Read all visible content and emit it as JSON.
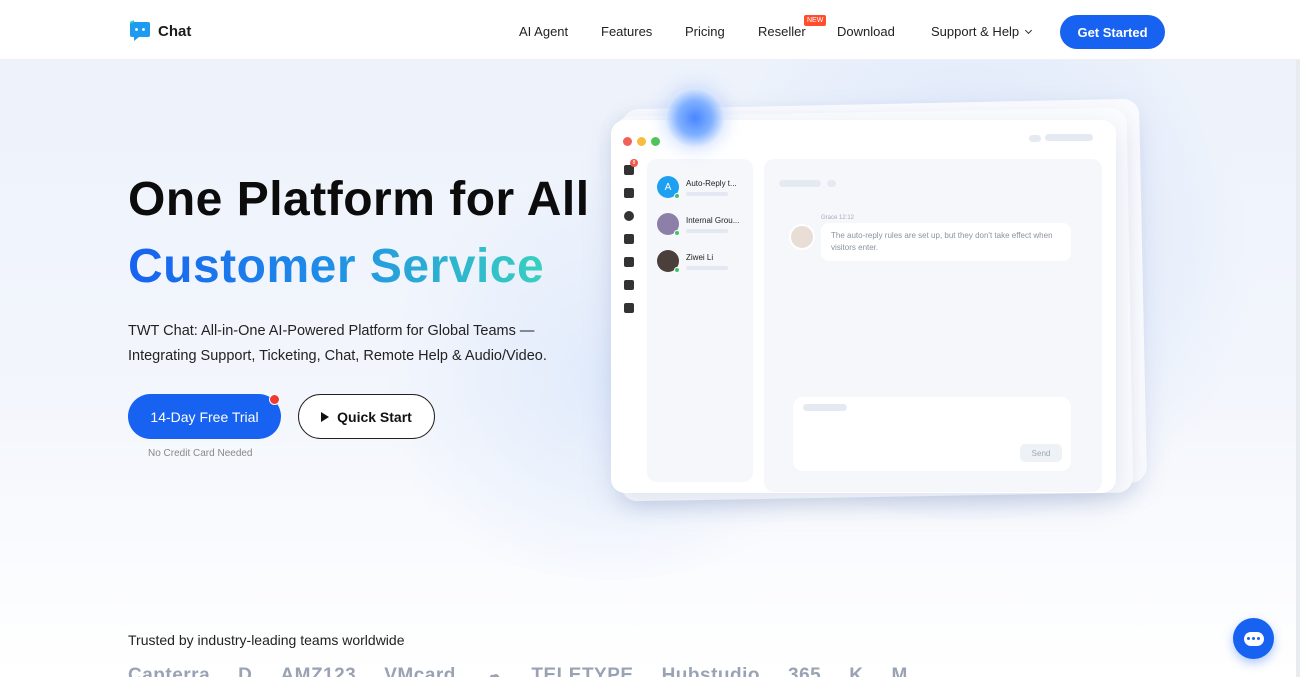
{
  "header": {
    "logo_text": "Chat",
    "nav": {
      "ai_agent": "AI Agent",
      "features": "Features",
      "pricing": "Pricing",
      "reseller": "Reseller",
      "reseller_badge": "NEW",
      "download": "Download",
      "support": "Support & Help"
    },
    "cta": "Get Started"
  },
  "hero": {
    "title_line1": "One Platform for All",
    "title_line2": "Customer Service",
    "description_line1": "TWT Chat: All-in-One AI-Powered Platform for Global Teams —",
    "description_line2": "Integrating Support, Ticketing, Chat, Remote Help & Audio/Video.",
    "trial_button": "14-Day Free Trial",
    "quick_start_button": "Quick Start",
    "no_card_note": "No Credit Card Needed"
  },
  "mockup": {
    "sidebar_badge": "8",
    "contacts": [
      {
        "name": "Auto-Reply t...",
        "avatar_letter": "A"
      },
      {
        "name": "Internal Grou...",
        "avatar_letter": ""
      },
      {
        "name": "Ziwei Li",
        "avatar_letter": ""
      }
    ],
    "message_meta": "Grace 12:12",
    "message_text": "The auto-reply rules are set up, but they don't take effect when visitors enter.",
    "send_label": "Send"
  },
  "trusted": {
    "heading": "Trusted by industry-leading teams worldwide",
    "logos": [
      "Capterra",
      "D",
      "AMZ123",
      "VMcard",
      "☁",
      "TELETYPE",
      "Hubstudio",
      "365",
      "K",
      "M"
    ]
  },
  "colors": {
    "primary": "#1762f0",
    "gradient_end": "#38d0bf",
    "badge_red": "#ff4d2e"
  }
}
